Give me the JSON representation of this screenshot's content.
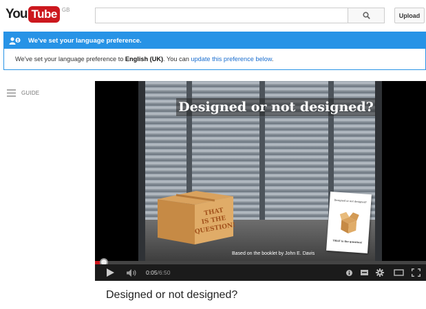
{
  "header": {
    "logo_you": "You",
    "logo_tube": "Tube",
    "logo_region": "GB",
    "search": {
      "value": "",
      "placeholder": ""
    },
    "upload_label": "Upload"
  },
  "language_banner": {
    "title": "We've set your language preference.",
    "body_prefix": "We've set your language preference to ",
    "language": "English (UK)",
    "body_middle": ". You can ",
    "link_text": "update this preference below",
    "body_suffix": "."
  },
  "guide": {
    "label": "GUIDE"
  },
  "video": {
    "slide_title": "Designed or not designed?",
    "box_text": [
      "THAT",
      "IS THE",
      "QUESTION!"
    ],
    "booklet_title": "Designed or not designed?",
    "booklet_question": "THAT is the question!",
    "caption": "Based on the booklet by John E. Davis",
    "time_current": "0:05",
    "time_separator": " / ",
    "time_duration": "6:50",
    "progress": 0.0122
  },
  "video_title": "Designed or not designed?",
  "colors": {
    "brand_red": "#cc181e",
    "banner_blue": "#2793e6",
    "link_blue": "#1a6ecf"
  }
}
